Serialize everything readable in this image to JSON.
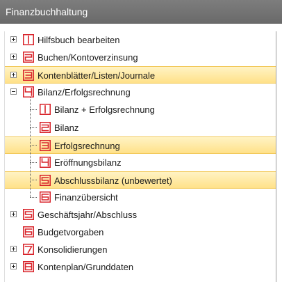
{
  "window": {
    "title": "Finanzbuchhaltung"
  },
  "tree": {
    "items": [
      {
        "label": "Hilfsbuch bearbeiten",
        "icon": "number-1-icon",
        "expander": "plus",
        "level": 0,
        "selected": false
      },
      {
        "label": "Buchen/Kontoverzinsung",
        "icon": "number-2-icon",
        "expander": "plus",
        "level": 0,
        "selected": false
      },
      {
        "label": "Kontenblätter/Listen/Journale",
        "icon": "number-3-icon",
        "expander": "plus",
        "level": 0,
        "selected": true
      },
      {
        "label": "Bilanz/Erfolgsrechnung",
        "icon": "number-4-icon",
        "expander": "minus",
        "level": 0,
        "selected": false
      },
      {
        "label": "Bilanz + Erfolgsrechnung",
        "icon": "number-1-icon",
        "expander": "none",
        "level": 1,
        "selected": false
      },
      {
        "label": "Bilanz",
        "icon": "number-2-icon",
        "expander": "none",
        "level": 1,
        "selected": false
      },
      {
        "label": "Erfolgsrechnung",
        "icon": "number-3-icon",
        "expander": "none",
        "level": 1,
        "selected": true
      },
      {
        "label": "Eröffnungsbilanz",
        "icon": "number-4-icon",
        "expander": "none",
        "level": 1,
        "selected": false
      },
      {
        "label": "Abschlussbilanz (unbewertet)",
        "icon": "number-5-icon",
        "expander": "none",
        "level": 1,
        "selected": true
      },
      {
        "label": "Finanzübersicht",
        "icon": "number-6-icon",
        "expander": "none",
        "level": 1,
        "selected": false
      },
      {
        "label": "Geschäftsjahr/Abschluss",
        "icon": "number-5-icon",
        "expander": "plus",
        "level": 0,
        "selected": false
      },
      {
        "label": "Budgetvorgaben",
        "icon": "number-6-icon",
        "expander": "none",
        "level": 0,
        "selected": false
      },
      {
        "label": "Konsolidierungen",
        "icon": "number-7-icon",
        "expander": "plus",
        "level": 0,
        "selected": false
      },
      {
        "label": "Kontenplan/Grunddaten",
        "icon": "number-8-icon",
        "expander": "plus",
        "level": 0,
        "selected": false
      }
    ]
  },
  "colors": {
    "icon": "#d8232a",
    "selection": "#ffe189",
    "title_bar": "#737373"
  }
}
